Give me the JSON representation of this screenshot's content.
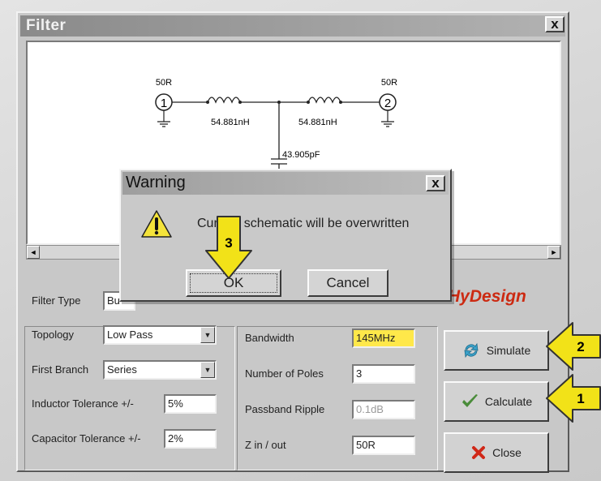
{
  "window": {
    "title": "Filter",
    "close_label": "x"
  },
  "schematic": {
    "port1_label": "50R",
    "port1_number": "1",
    "port2_label": "50R",
    "port2_number": "2",
    "inductor1_value": "54.881nH",
    "inductor2_value": "54.881nH",
    "capacitor_value": "43.905pF"
  },
  "scrollbar": {
    "left_arrow": "◄",
    "right_arrow": "►"
  },
  "form": {
    "filter_type_label": "Filter Type",
    "filter_type_value": "Bu",
    "topology_label": "Topology",
    "topology_value": "Low Pass",
    "first_branch_label": "First Branch",
    "first_branch_value": "Series",
    "inductor_tol_label": "Inductor Tolerance +/-",
    "inductor_tol_value": "5%",
    "capacitor_tol_label": "Capacitor Tolerance +/-",
    "capacitor_tol_value": "2%",
    "bandwidth_label": "Bandwidth",
    "bandwidth_value": "145MHz",
    "poles_label": "Number of Poles",
    "poles_value": "3",
    "ripple_label": "Passband Ripple",
    "ripple_value": "0.1dB",
    "z_label": "Z in / out",
    "z_value": "50R",
    "combo_arrow": "▼"
  },
  "logo": "HyDesign",
  "buttons": {
    "simulate": "Simulate",
    "calculate": "Calculate",
    "close": "Close"
  },
  "dialog": {
    "title": "Warning",
    "close_label": "x",
    "message": "Current schematic will be overwritten",
    "ok": "OK",
    "cancel": "Cancel"
  },
  "callouts": {
    "one": "1",
    "two": "2",
    "three": "3"
  },
  "colors": {
    "highlight": "#ffe84a",
    "callout": "#f2e218",
    "logo": "#cc2a12"
  }
}
